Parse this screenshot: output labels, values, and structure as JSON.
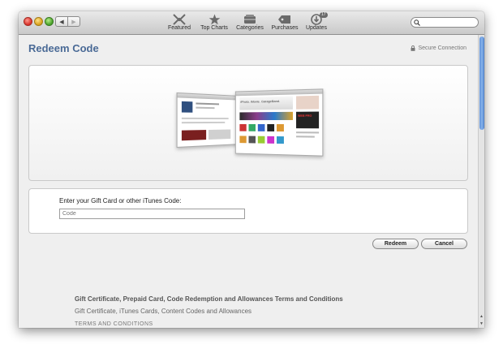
{
  "toolbar": {
    "items": [
      {
        "label": "Featured",
        "icon": "featured-icon"
      },
      {
        "label": "Top Charts",
        "icon": "star-icon"
      },
      {
        "label": "Categories",
        "icon": "categories-icon"
      },
      {
        "label": "Purchases",
        "icon": "tag-icon"
      },
      {
        "label": "Updates",
        "icon": "updates-icon",
        "badge": "17"
      }
    ],
    "search_placeholder": ""
  },
  "page": {
    "title": "Redeem Code",
    "secure_label": "Secure Connection"
  },
  "form": {
    "label": "Enter your Gift Card or other iTunes Code:",
    "placeholder": "Code",
    "value": ""
  },
  "buttons": {
    "redeem": "Redeem",
    "cancel": "Cancel"
  },
  "terms": {
    "title": "Gift Certificate, Prepaid Card, Code Redemption and Allowances Terms and Conditions",
    "subtitle": "Gift Certificate, iTunes Cards, Content Codes and Allowances",
    "caps": "TERMS AND CONDITIONS"
  },
  "banner": {
    "headline": "iPhoto. iMovie. GarageBand."
  },
  "colors": {
    "title": "#4a6a96",
    "scroll_thumb": "#6b9ee0"
  }
}
